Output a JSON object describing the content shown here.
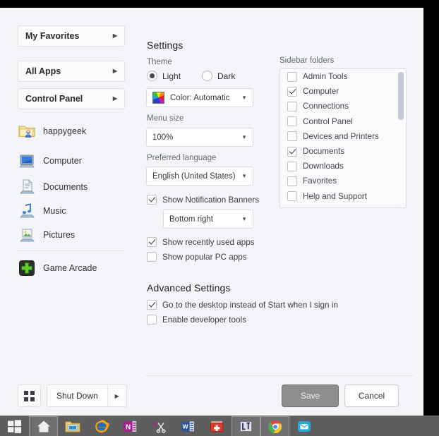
{
  "window": {
    "frame_color": "#000000",
    "panel_bg": "#f4f5f8"
  },
  "left_panel": {
    "nav_buttons": [
      {
        "label": "My Favorites",
        "caret": "caret-right-icon"
      },
      {
        "label": "All Apps",
        "caret": "caret-right-icon"
      },
      {
        "label": "Control Panel",
        "caret": "caret-right-icon"
      }
    ],
    "shell_items": [
      {
        "label": "happygeek",
        "icon": "user-folder-icon"
      },
      {
        "label": "Computer",
        "icon": "computer-icon"
      },
      {
        "label": "Documents",
        "icon": "documents-icon"
      },
      {
        "label": "Music",
        "icon": "music-icon"
      },
      {
        "label": "Pictures",
        "icon": "pictures-icon"
      }
    ],
    "pinned_items": [
      {
        "label": "Game Arcade",
        "icon": "game-arcade-icon"
      }
    ]
  },
  "settings": {
    "title": "Settings",
    "theme": {
      "label": "Theme",
      "options": [
        {
          "label": "Light",
          "selected": true
        },
        {
          "label": "Dark",
          "selected": false
        }
      ],
      "color_combo": {
        "value": "Color: Automatic",
        "icon": "color-wheel-icon"
      }
    },
    "menu_size": {
      "label": "Menu size",
      "value": "100%"
    },
    "preferred_language": {
      "label": "Preferred language",
      "value": "English (United States)"
    },
    "notification_banners": {
      "label": "Show Notification Banners",
      "checked": true,
      "position_value": "Bottom right"
    },
    "checkboxes": [
      {
        "label": "Show recently used apps",
        "checked": true
      },
      {
        "label": "Show popular PC apps",
        "checked": false
      }
    ],
    "advanced": {
      "title": "Advanced Settings",
      "checkboxes": [
        {
          "label": "Go to the desktop instead of Start when I sign in",
          "checked": true
        },
        {
          "label": "Enable developer tools",
          "checked": false
        }
      ]
    },
    "sidebar_folders": {
      "label": "Sidebar folders",
      "items": [
        {
          "label": "Admin Tools",
          "checked": false
        },
        {
          "label": "Computer",
          "checked": true
        },
        {
          "label": "Connections",
          "checked": false
        },
        {
          "label": "Control Panel",
          "checked": false
        },
        {
          "label": "Devices and Printers",
          "checked": false
        },
        {
          "label": "Documents",
          "checked": true
        },
        {
          "label": "Downloads",
          "checked": false
        },
        {
          "label": "Favorites",
          "checked": false
        },
        {
          "label": "Help and Support",
          "checked": false
        }
      ]
    }
  },
  "footer": {
    "apps_button_icon": "app-grid-icon",
    "shutdown_label": "Shut Down",
    "shutdown_caret": "caret-right-icon",
    "save_label": "Save",
    "cancel_label": "Cancel",
    "save_color": "#8e8e8e"
  },
  "taskbar": {
    "bg_color": "#5e5e5e",
    "items": [
      {
        "name": "start-button",
        "icon": "windows-logo-icon",
        "active": false
      },
      {
        "name": "classic-start-home",
        "icon": "home-icon",
        "active": true
      },
      {
        "name": "file-explorer",
        "icon": "folder-icon",
        "active": false
      },
      {
        "name": "internet-explorer",
        "icon": "internet-explorer-icon",
        "active": false
      },
      {
        "name": "onenote",
        "icon": "onenote-icon",
        "active": false
      },
      {
        "name": "snipping-tool",
        "icon": "snipping-tool-icon",
        "active": false
      },
      {
        "name": "word",
        "icon": "word-icon",
        "active": false
      },
      {
        "name": "first-aid",
        "icon": "first-aid-icon",
        "active": false
      },
      {
        "name": "unknown-app",
        "icon": "paint-app-icon",
        "active": true
      },
      {
        "name": "google-chrome",
        "icon": "chrome-icon",
        "active": true
      },
      {
        "name": "mail",
        "icon": "mail-icon",
        "active": false
      }
    ]
  }
}
